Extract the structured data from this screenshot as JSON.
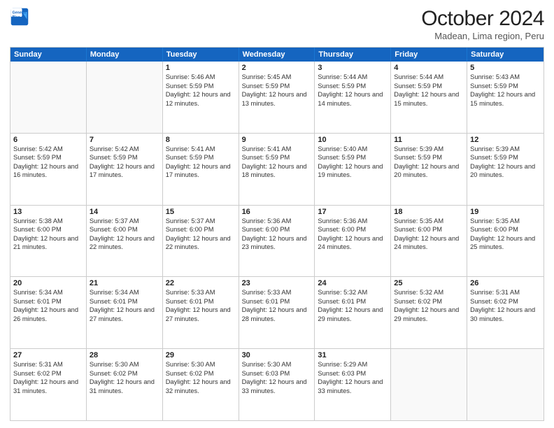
{
  "logo": {
    "general": "General",
    "blue": "Blue"
  },
  "title": "October 2024",
  "location": "Madean, Lima region, Peru",
  "weekdays": [
    "Sunday",
    "Monday",
    "Tuesday",
    "Wednesday",
    "Thursday",
    "Friday",
    "Saturday"
  ],
  "weeks": [
    [
      {
        "day": "",
        "sunrise": "",
        "sunset": "",
        "daylight": ""
      },
      {
        "day": "",
        "sunrise": "",
        "sunset": "",
        "daylight": ""
      },
      {
        "day": "1",
        "sunrise": "Sunrise: 5:46 AM",
        "sunset": "Sunset: 5:59 PM",
        "daylight": "Daylight: 12 hours and 12 minutes."
      },
      {
        "day": "2",
        "sunrise": "Sunrise: 5:45 AM",
        "sunset": "Sunset: 5:59 PM",
        "daylight": "Daylight: 12 hours and 13 minutes."
      },
      {
        "day": "3",
        "sunrise": "Sunrise: 5:44 AM",
        "sunset": "Sunset: 5:59 PM",
        "daylight": "Daylight: 12 hours and 14 minutes."
      },
      {
        "day": "4",
        "sunrise": "Sunrise: 5:44 AM",
        "sunset": "Sunset: 5:59 PM",
        "daylight": "Daylight: 12 hours and 15 minutes."
      },
      {
        "day": "5",
        "sunrise": "Sunrise: 5:43 AM",
        "sunset": "Sunset: 5:59 PM",
        "daylight": "Daylight: 12 hours and 15 minutes."
      }
    ],
    [
      {
        "day": "6",
        "sunrise": "Sunrise: 5:42 AM",
        "sunset": "Sunset: 5:59 PM",
        "daylight": "Daylight: 12 hours and 16 minutes."
      },
      {
        "day": "7",
        "sunrise": "Sunrise: 5:42 AM",
        "sunset": "Sunset: 5:59 PM",
        "daylight": "Daylight: 12 hours and 17 minutes."
      },
      {
        "day": "8",
        "sunrise": "Sunrise: 5:41 AM",
        "sunset": "Sunset: 5:59 PM",
        "daylight": "Daylight: 12 hours and 17 minutes."
      },
      {
        "day": "9",
        "sunrise": "Sunrise: 5:41 AM",
        "sunset": "Sunset: 5:59 PM",
        "daylight": "Daylight: 12 hours and 18 minutes."
      },
      {
        "day": "10",
        "sunrise": "Sunrise: 5:40 AM",
        "sunset": "Sunset: 5:59 PM",
        "daylight": "Daylight: 12 hours and 19 minutes."
      },
      {
        "day": "11",
        "sunrise": "Sunrise: 5:39 AM",
        "sunset": "Sunset: 5:59 PM",
        "daylight": "Daylight: 12 hours and 20 minutes."
      },
      {
        "day": "12",
        "sunrise": "Sunrise: 5:39 AM",
        "sunset": "Sunset: 5:59 PM",
        "daylight": "Daylight: 12 hours and 20 minutes."
      }
    ],
    [
      {
        "day": "13",
        "sunrise": "Sunrise: 5:38 AM",
        "sunset": "Sunset: 6:00 PM",
        "daylight": "Daylight: 12 hours and 21 minutes."
      },
      {
        "day": "14",
        "sunrise": "Sunrise: 5:37 AM",
        "sunset": "Sunset: 6:00 PM",
        "daylight": "Daylight: 12 hours and 22 minutes."
      },
      {
        "day": "15",
        "sunrise": "Sunrise: 5:37 AM",
        "sunset": "Sunset: 6:00 PM",
        "daylight": "Daylight: 12 hours and 22 minutes."
      },
      {
        "day": "16",
        "sunrise": "Sunrise: 5:36 AM",
        "sunset": "Sunset: 6:00 PM",
        "daylight": "Daylight: 12 hours and 23 minutes."
      },
      {
        "day": "17",
        "sunrise": "Sunrise: 5:36 AM",
        "sunset": "Sunset: 6:00 PM",
        "daylight": "Daylight: 12 hours and 24 minutes."
      },
      {
        "day": "18",
        "sunrise": "Sunrise: 5:35 AM",
        "sunset": "Sunset: 6:00 PM",
        "daylight": "Daylight: 12 hours and 24 minutes."
      },
      {
        "day": "19",
        "sunrise": "Sunrise: 5:35 AM",
        "sunset": "Sunset: 6:00 PM",
        "daylight": "Daylight: 12 hours and 25 minutes."
      }
    ],
    [
      {
        "day": "20",
        "sunrise": "Sunrise: 5:34 AM",
        "sunset": "Sunset: 6:01 PM",
        "daylight": "Daylight: 12 hours and 26 minutes."
      },
      {
        "day": "21",
        "sunrise": "Sunrise: 5:34 AM",
        "sunset": "Sunset: 6:01 PM",
        "daylight": "Daylight: 12 hours and 27 minutes."
      },
      {
        "day": "22",
        "sunrise": "Sunrise: 5:33 AM",
        "sunset": "Sunset: 6:01 PM",
        "daylight": "Daylight: 12 hours and 27 minutes."
      },
      {
        "day": "23",
        "sunrise": "Sunrise: 5:33 AM",
        "sunset": "Sunset: 6:01 PM",
        "daylight": "Daylight: 12 hours and 28 minutes."
      },
      {
        "day": "24",
        "sunrise": "Sunrise: 5:32 AM",
        "sunset": "Sunset: 6:01 PM",
        "daylight": "Daylight: 12 hours and 29 minutes."
      },
      {
        "day": "25",
        "sunrise": "Sunrise: 5:32 AM",
        "sunset": "Sunset: 6:02 PM",
        "daylight": "Daylight: 12 hours and 29 minutes."
      },
      {
        "day": "26",
        "sunrise": "Sunrise: 5:31 AM",
        "sunset": "Sunset: 6:02 PM",
        "daylight": "Daylight: 12 hours and 30 minutes."
      }
    ],
    [
      {
        "day": "27",
        "sunrise": "Sunrise: 5:31 AM",
        "sunset": "Sunset: 6:02 PM",
        "daylight": "Daylight: 12 hours and 31 minutes."
      },
      {
        "day": "28",
        "sunrise": "Sunrise: 5:30 AM",
        "sunset": "Sunset: 6:02 PM",
        "daylight": "Daylight: 12 hours and 31 minutes."
      },
      {
        "day": "29",
        "sunrise": "Sunrise: 5:30 AM",
        "sunset": "Sunset: 6:02 PM",
        "daylight": "Daylight: 12 hours and 32 minutes."
      },
      {
        "day": "30",
        "sunrise": "Sunrise: 5:30 AM",
        "sunset": "Sunset: 6:03 PM",
        "daylight": "Daylight: 12 hours and 33 minutes."
      },
      {
        "day": "31",
        "sunrise": "Sunrise: 5:29 AM",
        "sunset": "Sunset: 6:03 PM",
        "daylight": "Daylight: 12 hours and 33 minutes."
      },
      {
        "day": "",
        "sunrise": "",
        "sunset": "",
        "daylight": ""
      },
      {
        "day": "",
        "sunrise": "",
        "sunset": "",
        "daylight": ""
      }
    ]
  ]
}
